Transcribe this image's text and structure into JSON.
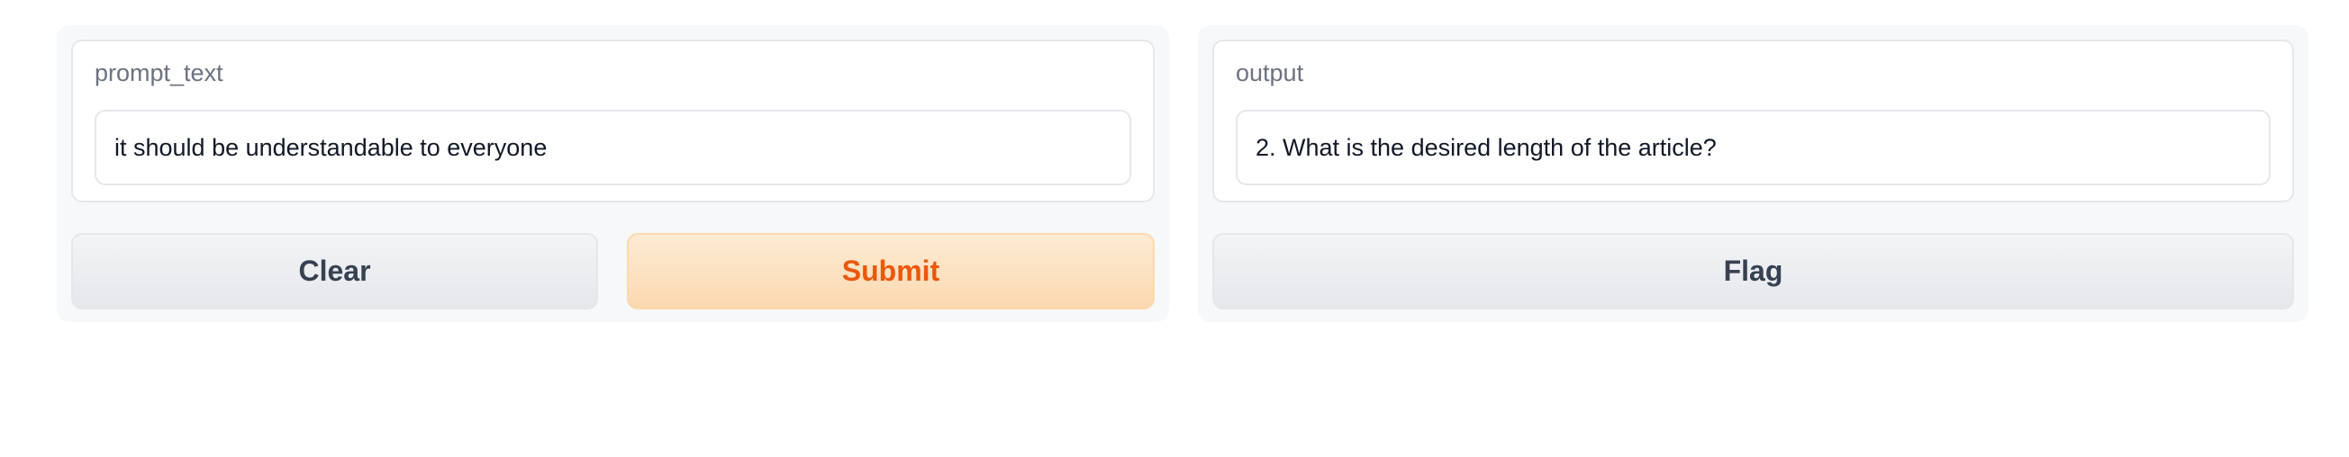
{
  "input_panel": {
    "label": "prompt_text",
    "value": "it should be understandable to everyone",
    "clear_label": "Clear",
    "submit_label": "Submit"
  },
  "output_panel": {
    "label": "output",
    "value": "2. What is the desired length of the article?",
    "flag_label": "Flag"
  },
  "colors": {
    "primary_text": "#ea580c",
    "primary_bg": "#fde4c6",
    "panel_bg": "#f7f8fa"
  }
}
